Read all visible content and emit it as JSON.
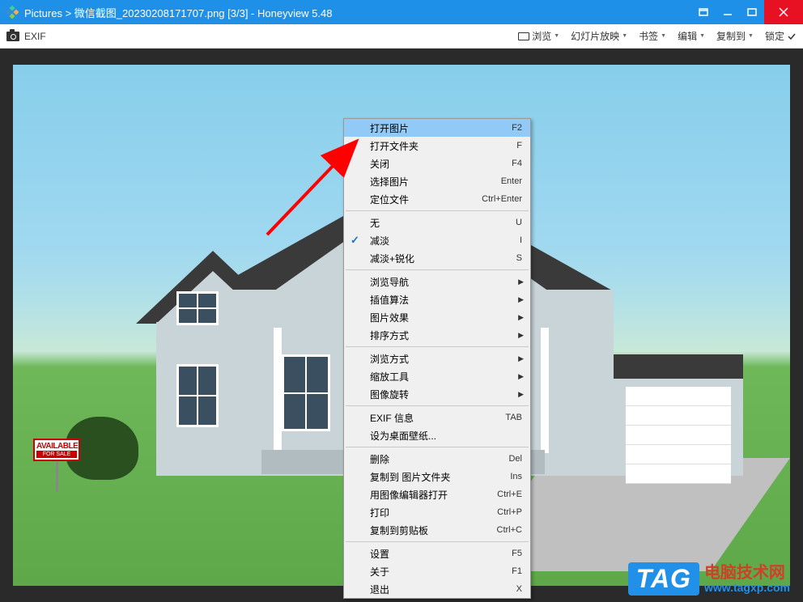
{
  "titlebar": {
    "title": "Pictures > 微信截图_20230208171707.png [3/3] - Honeyview 5.48"
  },
  "toolbar": {
    "exif": "EXIF",
    "menus": {
      "browse": "浏览",
      "slideshow": "幻灯片放映",
      "bookmark": "书签",
      "edit": "编辑",
      "copyto": "复制到",
      "lock": "锁定"
    }
  },
  "sign": {
    "available": "AVAILABLE",
    "forsale": "FOR SALE"
  },
  "contextMenu": {
    "items": [
      {
        "label": "打开图片",
        "shortcut": "F2",
        "highlighted": true
      },
      {
        "label": "打开文件夹",
        "shortcut": "F"
      },
      {
        "label": "关闭",
        "shortcut": "F4"
      },
      {
        "label": "选择图片",
        "shortcut": "Enter"
      },
      {
        "label": "定位文件",
        "shortcut": "Ctrl+Enter"
      },
      {
        "sep": true
      },
      {
        "label": "无",
        "shortcut": "U"
      },
      {
        "label": "减淡",
        "shortcut": "I",
        "checked": true
      },
      {
        "label": "减淡+锐化",
        "shortcut": "S"
      },
      {
        "sep": true
      },
      {
        "label": "浏览导航",
        "submenu": true
      },
      {
        "label": "插值算法",
        "submenu": true
      },
      {
        "label": "图片效果",
        "submenu": true
      },
      {
        "label": "排序方式",
        "submenu": true
      },
      {
        "sep": true
      },
      {
        "label": "浏览方式",
        "submenu": true
      },
      {
        "label": "缩放工具",
        "submenu": true
      },
      {
        "label": "图像旋转",
        "submenu": true
      },
      {
        "sep": true
      },
      {
        "label": "EXIF 信息",
        "shortcut": "TAB"
      },
      {
        "label": "设为桌面壁纸..."
      },
      {
        "sep": true
      },
      {
        "label": "删除",
        "shortcut": "Del"
      },
      {
        "label": "复制到 图片文件夹",
        "shortcut": "Ins"
      },
      {
        "label": "用图像编辑器打开",
        "shortcut": "Ctrl+E"
      },
      {
        "label": "打印",
        "shortcut": "Ctrl+P"
      },
      {
        "label": "复制到剪贴板",
        "shortcut": "Ctrl+C"
      },
      {
        "sep": true
      },
      {
        "label": "设置",
        "shortcut": "F5"
      },
      {
        "label": "关于",
        "shortcut": "F1"
      },
      {
        "label": "退出",
        "shortcut": "X"
      }
    ]
  },
  "watermark": {
    "tag": "TAG",
    "cn": "电脑技术网",
    "url": "www.tagxp.com"
  },
  "colors": {
    "titlebar": "#1e90e8",
    "close": "#e81123",
    "highlight": "#91c9f7",
    "arrow": "#ff0000"
  }
}
